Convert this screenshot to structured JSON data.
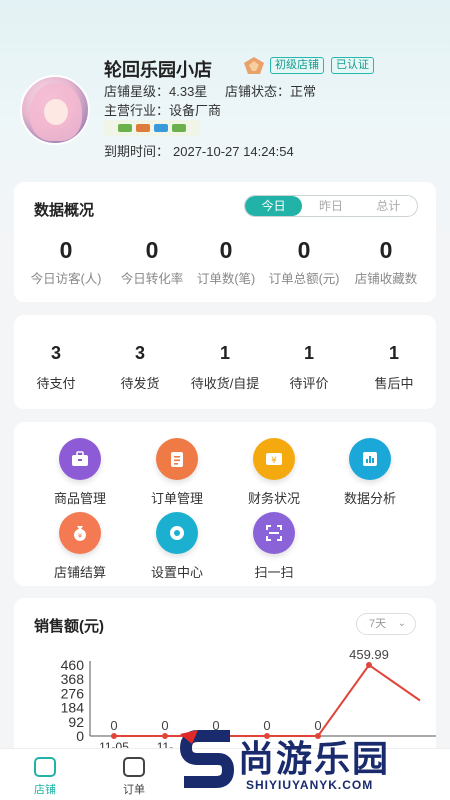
{
  "shop": {
    "name": "轮回乐园小店",
    "level_tag": "初级店铺",
    "verified_tag": "已认证",
    "rating_label": "店铺星级：",
    "rating": "4.33星",
    "status_label": "店铺状态：",
    "status": "正常",
    "industry_label": "主营行业：",
    "industry": "设备厂商",
    "expiry_label": "到期时间：",
    "expiry": "2027-10-27 14:24:54"
  },
  "overview": {
    "title": "数据概况",
    "tabs": [
      "今日",
      "昨日",
      "总计"
    ],
    "active_tab": "今日",
    "stats": [
      {
        "value": "0",
        "label": "今日访客(人)"
      },
      {
        "value": "0",
        "label": "今日转化率"
      },
      {
        "value": "0",
        "label": "订单数(笔)"
      },
      {
        "value": "0",
        "label": "订单总额(元)"
      },
      {
        "value": "0",
        "label": "店铺收藏数"
      }
    ]
  },
  "orders": [
    {
      "value": "3",
      "label": "待支付"
    },
    {
      "value": "3",
      "label": "待发货"
    },
    {
      "value": "1",
      "label": "待收货/自提"
    },
    {
      "value": "1",
      "label": "待评价"
    },
    {
      "value": "1",
      "label": "售后中"
    }
  ],
  "tools": [
    {
      "label": "商品管理",
      "icon": "briefcase-icon",
      "color": "#8e5bd6"
    },
    {
      "label": "订单管理",
      "icon": "clipboard-icon",
      "color": "#ef7a46"
    },
    {
      "label": "财务状况",
      "icon": "money-icon",
      "color": "#f4a90f"
    },
    {
      "label": "数据分析",
      "icon": "analytics-icon",
      "color": "#1ba7d8"
    },
    {
      "label": "店铺结算",
      "icon": "moneybag-icon",
      "color": "#f37a52"
    },
    {
      "label": "设置中心",
      "icon": "gear-icon",
      "color": "#1bb0cf"
    },
    {
      "label": "扫一扫",
      "icon": "scan-icon",
      "color": "#8a63d8"
    }
  ],
  "sales": {
    "title": "销售额(元)",
    "range": "7天",
    "chart_data": {
      "type": "line",
      "y_ticks": [
        "460",
        "368",
        "276",
        "184",
        "92",
        "0"
      ],
      "ylim": [
        0,
        460
      ],
      "x_labels_visible": [
        "11-05",
        "11-"
      ],
      "point_labels": [
        "0",
        "0",
        "0",
        "0",
        "0",
        "459.99"
      ],
      "values": [
        0,
        0,
        0,
        0,
        0,
        459.99,
        230
      ]
    }
  },
  "tabbar": {
    "items": [
      {
        "label": "店铺",
        "active": true
      },
      {
        "label": "订单",
        "active": false
      }
    ]
  },
  "watermark": {
    "text": "尚游乐园",
    "domain": "SHIYIUYANYK.COM"
  },
  "colors": {
    "accent": "#22b3a8",
    "line": "#e0453a"
  }
}
